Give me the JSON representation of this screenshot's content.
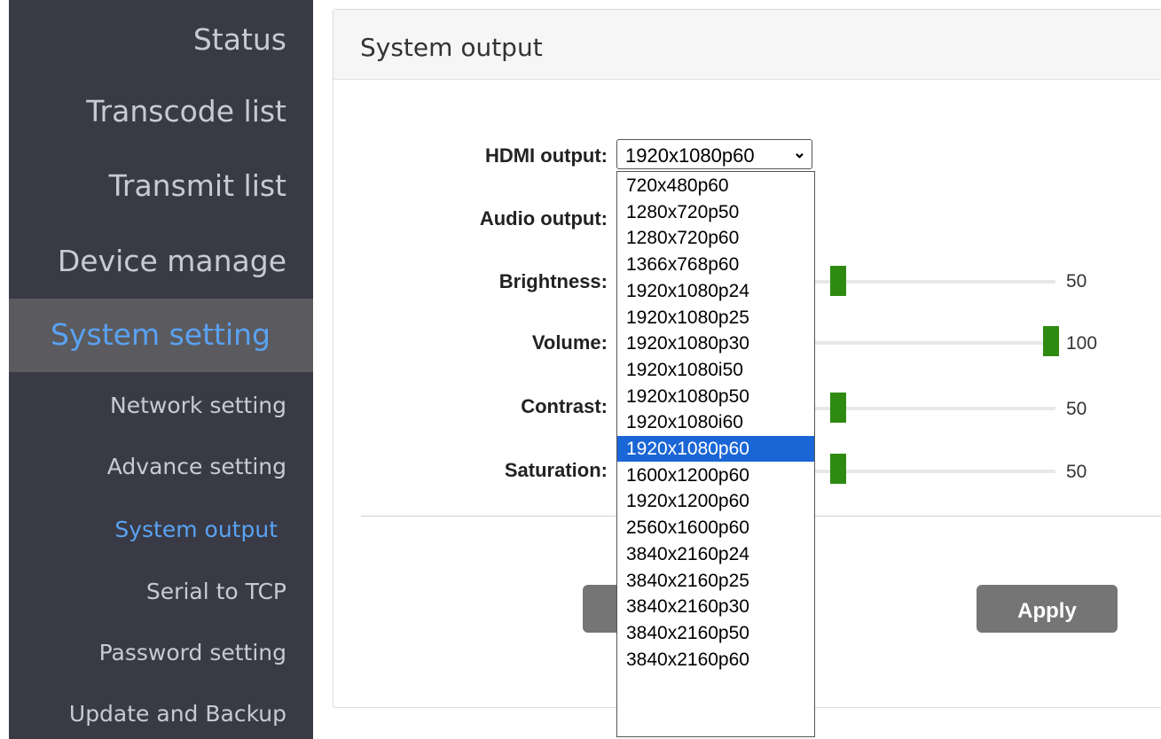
{
  "sidebar": {
    "items": [
      {
        "label": "Status"
      },
      {
        "label": "Transcode list"
      },
      {
        "label": "Transmit list"
      },
      {
        "label": "Device manage"
      },
      {
        "label": "System setting"
      },
      {
        "label": "Network setting"
      },
      {
        "label": "Advance setting"
      },
      {
        "label": "System output"
      },
      {
        "label": "Serial to TCP"
      },
      {
        "label": "Password setting"
      },
      {
        "label": "Update and Backup"
      }
    ]
  },
  "panel": {
    "title": "System output",
    "labels": {
      "hdmi": "HDMI output:",
      "audio": "Audio output:",
      "brightness": "Brightness:",
      "volume": "Volume:",
      "contrast": "Contrast:",
      "saturation": "Saturation:"
    },
    "hdmi_selected": "1920x1080p60",
    "sliders": {
      "brightness": {
        "value": "50"
      },
      "volume": {
        "value": "100"
      },
      "contrast": {
        "value": "50"
      },
      "saturation": {
        "value": "50"
      }
    },
    "apply_label": "Apply"
  },
  "dropdown": {
    "selected_index": 10,
    "options": [
      "720x480p60",
      "1280x720p50",
      "1280x720p60",
      "1366x768p60",
      "1920x1080p24",
      "1920x1080p25",
      "1920x1080p30",
      "1920x1080i50",
      "1920x1080p50",
      "1920x1080i60",
      "1920x1080p60",
      "1600x1200p60",
      "1920x1200p60",
      "2560x1600p60",
      "3840x2160p24",
      "3840x2160p25",
      "3840x2160p30",
      "3840x2160p50",
      "3840x2160p60"
    ]
  },
  "colors": {
    "sidebar_bg": "#393a45",
    "active_bg": "#5b5b5f",
    "accent_blue": "#5aa2f3",
    "slider_thumb": "#2f8a12",
    "option_selected": "#1a66d6"
  }
}
